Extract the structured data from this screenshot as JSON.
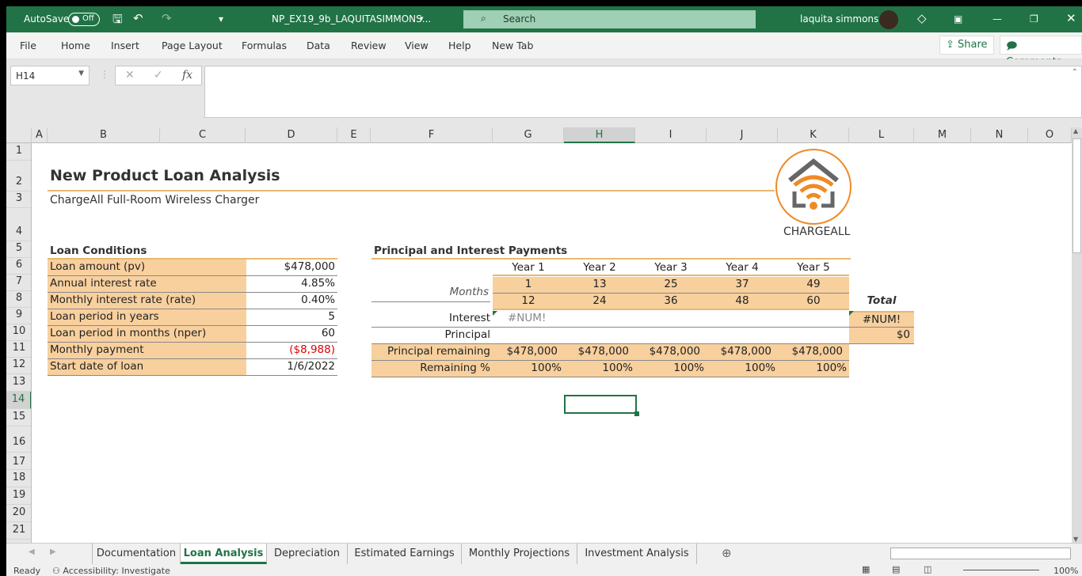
{
  "titlebar": {
    "autosave": "AutoSave",
    "toggle": "Off",
    "filename": "NP_EX19_9b_LAQUITASIMMONS...",
    "search": "Search",
    "user": "laquita simmons"
  },
  "menu": [
    "File",
    "Home",
    "Insert",
    "Page Layout",
    "Formulas",
    "Data",
    "Review",
    "View",
    "Help",
    "New Tab"
  ],
  "share": "Share",
  "comments": "Comments",
  "namebox": "H14",
  "columns": [
    "A",
    "B",
    "C",
    "D",
    "E",
    "F",
    "G",
    "H",
    "I",
    "J",
    "K",
    "L",
    "M",
    "N",
    "O"
  ],
  "rows": [
    "1",
    "2",
    "3",
    "4",
    "5",
    "6",
    "7",
    "8",
    "9",
    "10",
    "11",
    "12",
    "13",
    "14",
    "15",
    "16",
    "17",
    "18",
    "19",
    "20",
    "21"
  ],
  "sheet": {
    "title": "New Product Loan Analysis",
    "subtitle": "ChargeAll Full-Room Wireless Charger",
    "logo_text": "CHARGEALL",
    "loan_header": "Loan Conditions",
    "loan": [
      {
        "label": "Loan amount (pv)",
        "value": "$478,000"
      },
      {
        "label": "Annual interest rate",
        "value": "4.85%"
      },
      {
        "label": "Monthly interest rate (rate)",
        "value": "0.40%"
      },
      {
        "label": "Loan period in years",
        "value": "5"
      },
      {
        "label": "Loan period in months (nper)",
        "value": "60"
      },
      {
        "label": "Monthly payment",
        "value": "($8,988)"
      },
      {
        "label": "Start date of loan",
        "value": "1/6/2022"
      }
    ],
    "pi_header": "Principal and Interest Payments",
    "years": [
      "Year 1",
      "Year 2",
      "Year 3",
      "Year 4",
      "Year 5"
    ],
    "months_label": "Months",
    "start_months": [
      "1",
      "13",
      "25",
      "37",
      "49"
    ],
    "end_months": [
      "12",
      "24",
      "36",
      "48",
      "60"
    ],
    "total_label": "Total",
    "interest_label": "Interest",
    "interest_g": "#NUM!",
    "interest_total": "#NUM!",
    "principal_label": "Principal",
    "principal_total": "$0",
    "remaining_label": "Principal remaining",
    "remaining": [
      "$478,000",
      "$478,000",
      "$478,000",
      "$478,000",
      "$478,000"
    ],
    "pct_label": "Remaining %",
    "pct": [
      "100%",
      "100%",
      "100%",
      "100%",
      "100%"
    ]
  },
  "tabs": [
    "Documentation",
    "Loan Analysis",
    "Depreciation",
    "Estimated Earnings",
    "Monthly Projections",
    "Investment Analysis"
  ],
  "status": {
    "ready": "Ready",
    "accessibility": "Accessibility: Investigate",
    "zoom": "100%"
  },
  "colors": {
    "accent": "#217346",
    "orange_fill": "#f8d09e",
    "orange_line": "#e8b870",
    "negative": "#e00000"
  }
}
